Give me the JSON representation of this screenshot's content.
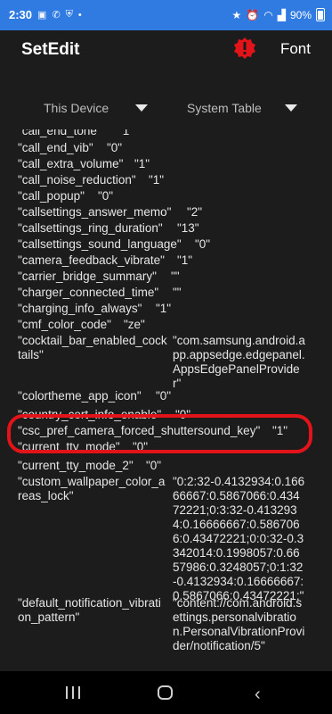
{
  "status_bar": {
    "time": "2:30",
    "battery": "90%",
    "notif_icons": [
      "gallery-icon",
      "wifi-calling-icon",
      "shield-icon",
      "dot-icon"
    ],
    "sys_icons": [
      "star-icon",
      "alarm-icon",
      "wifi-icon",
      "signal-icon",
      "battery-icon"
    ]
  },
  "app_bar": {
    "title": "SetEdit",
    "font_label": "Font",
    "alert_color": "#e2141a"
  },
  "spinners": {
    "device": "This Device",
    "table": "System Table"
  },
  "rows": [
    {
      "key": "\"call_end_tone\"",
      "value": "\"1\""
    },
    {
      "key": "\"call_end_vib\"",
      "value": "\"0\""
    },
    {
      "key": "\"call_extra_volume\"",
      "value": "\"1\""
    },
    {
      "key": "\"call_noise_reduction\"",
      "value": "\"1\""
    },
    {
      "key": "\"call_popup\"",
      "value": "\"0\""
    },
    {
      "key": "\"callsettings_answer_memo\"",
      "value": "\"2\""
    },
    {
      "key": "\"callsettings_ring_duration\"",
      "value": "\"13\""
    },
    {
      "key": "\"callsettings_sound_language\"",
      "value": "\"0\""
    },
    {
      "key": "\"camera_feedback_vibrate\"",
      "value": "\"1\""
    },
    {
      "key": "\"carrier_bridge_summary\"",
      "value": "\"\""
    },
    {
      "key": "\"charger_connected_time\"",
      "value": "\"\""
    },
    {
      "key": "\"charging_info_always\"",
      "value": "\"1\""
    },
    {
      "key": "\"cmf_color_code\"",
      "value": "\"ze\""
    },
    {
      "key": "\"cocktail_bar_enabled_cocktails\"",
      "value": "\"com.samsung.android.app.appsedge.edgepanel.AppsEdgePanelProvider\""
    },
    {
      "key": "\"colortheme_app_icon\"",
      "value": "\"0\""
    },
    {
      "key": "\"country_cert_info_enable\"",
      "value": "\"0\""
    },
    {
      "key": "\"csc_pref_camera_forced_shuttersound_key\"",
      "value": "\"1\""
    },
    {
      "key": "\"current_tty_mode\"",
      "value": "\"0\""
    },
    {
      "key": "\"current_tty_mode_2\"",
      "value": "\"0\""
    },
    {
      "key": "\"custom_wallpaper_color_areas_lock\"",
      "value": "\"0:2:32-0.4132934:0.16666667:0.5867066:0.43472221;0:3:32-0.4132934:0.16666667:0.5867066:0.43472221;0:0:32-0.3342014:0.1998057:0.6657986:0.3248057;0:1:32-0.4132934:0.16666667:0.5867066:0.43472221;\""
    },
    {
      "key": "\"default_notification_vibration_pattern\"",
      "value": "\"content://com.android.settings.personalvibration.PersonalVibrationProvider/notification/5\""
    }
  ],
  "nav_bar": {
    "items": [
      "recents-button",
      "home-button",
      "back-button"
    ]
  }
}
